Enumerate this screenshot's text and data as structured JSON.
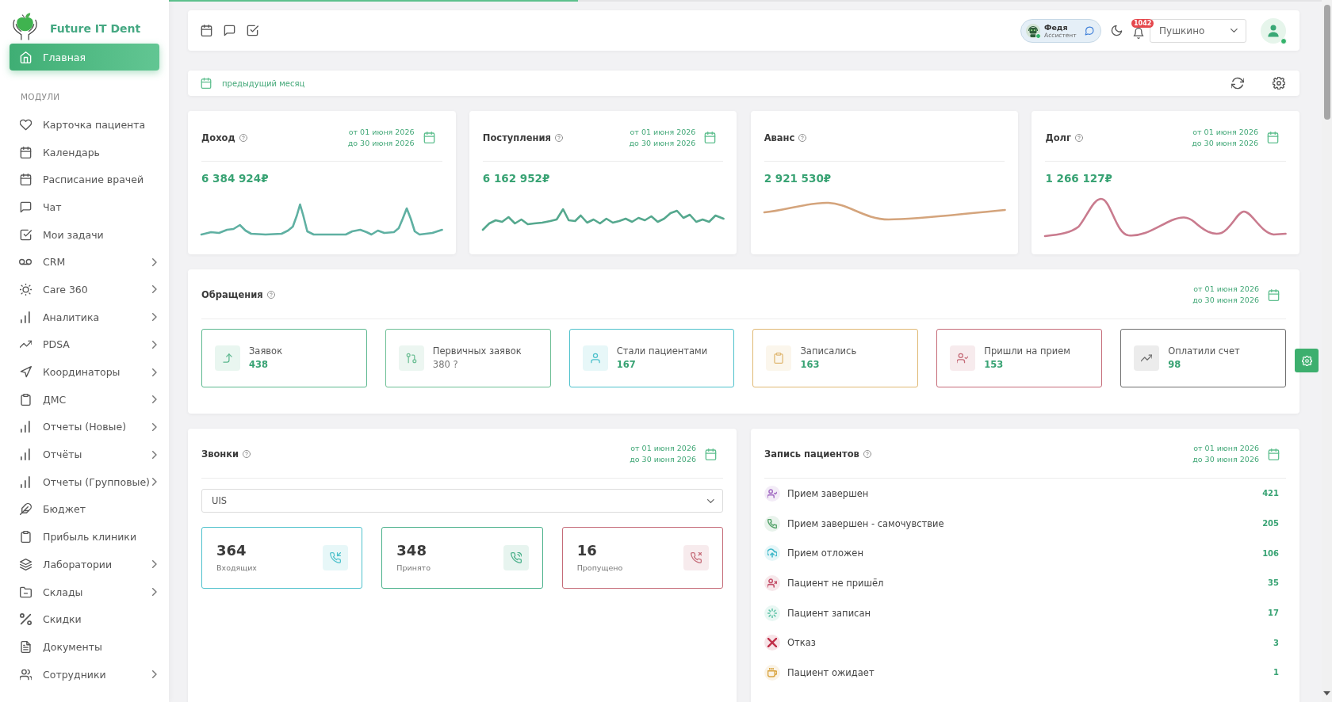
{
  "brand": {
    "name": "Future IT Dent"
  },
  "sidebar": {
    "home": {
      "label": "Главная",
      "selected": true
    },
    "section_label": "МОДУЛИ",
    "items": [
      {
        "label": "Карточка пациента",
        "selected": false,
        "has_submenu": false
      },
      {
        "label": "Календарь",
        "selected": false,
        "has_submenu": false
      },
      {
        "label": "Расписание врачей",
        "selected": false,
        "has_submenu": false
      },
      {
        "label": "Чат",
        "selected": false,
        "has_submenu": false
      },
      {
        "label": "Мои задачи",
        "selected": false,
        "has_submenu": false
      },
      {
        "label": "CRM",
        "selected": false,
        "has_submenu": true
      },
      {
        "label": "Care 360",
        "selected": false,
        "has_submenu": true
      },
      {
        "label": "Аналитика",
        "selected": false,
        "has_submenu": true
      },
      {
        "label": "PDSA",
        "selected": false,
        "has_submenu": true
      },
      {
        "label": "Координаторы",
        "selected": false,
        "has_submenu": true
      },
      {
        "label": "ДМС",
        "selected": false,
        "has_submenu": true
      },
      {
        "label": "Отчеты (Новые)",
        "selected": false,
        "has_submenu": true
      },
      {
        "label": "Отчёты",
        "selected": false,
        "has_submenu": true
      },
      {
        "label": "Отчеты (Групповые)",
        "selected": false,
        "has_submenu": true
      },
      {
        "label": "Бюджет",
        "selected": false,
        "has_submenu": false
      },
      {
        "label": "Прибыль клиники",
        "selected": false,
        "has_submenu": false
      },
      {
        "label": "Лаборатории",
        "selected": false,
        "has_submenu": true
      },
      {
        "label": "Склады",
        "selected": false,
        "has_submenu": true
      },
      {
        "label": "Скидки",
        "selected": false,
        "has_submenu": false
      },
      {
        "label": "Документы",
        "selected": false,
        "has_submenu": false
      },
      {
        "label": "Сотрудники",
        "selected": false,
        "has_submenu": true
      }
    ]
  },
  "page_loader": {
    "level": 0.355
  },
  "topbar": {
    "assistant": {
      "name": "Федя",
      "role": "Ассистент",
      "online": true
    },
    "notifications": {
      "count": "1042"
    },
    "clinic_select": {
      "value": "Пушкино"
    },
    "user": {
      "online": true
    }
  },
  "filter_bar": {
    "period": "предыдущий месяц"
  },
  "stat_cards": [
    {
      "title": "Доход",
      "date_from": "от 01 июня 2026",
      "date_to": "до 30 июня 2026",
      "value": "6 384 924₽",
      "color": "#5fb0a2"
    },
    {
      "title": "Поступления",
      "date_from": "от 01 июня 2026",
      "date_to": "до 30 июня 2026",
      "value": "6 162 952₽",
      "color": "#55a88e"
    },
    {
      "title": "Аванс",
      "value": "2 921 530₽",
      "color": "#d4a47c"
    },
    {
      "title": "Долг",
      "date_from": "от 01 июня 2026",
      "date_to": "до 30 июня 2026",
      "value": "1 266 127₽",
      "color": "#c97b8e"
    }
  ],
  "requests": {
    "title": "Обращения",
    "date_from": "от 01 июня 2026",
    "date_to": "до 30 июня 2026",
    "tiles": [
      {
        "label": "Заявок",
        "value": "438",
        "color": "#5cb88f",
        "muted": false
      },
      {
        "label": "Первичных заявок",
        "value": "380 ?",
        "color": "#6dbf95",
        "muted": true
      },
      {
        "label": "Стали пациентами",
        "value": "167",
        "color": "#4ec1cc",
        "muted": false
      },
      {
        "label": "Записались",
        "value": "163",
        "color": "#e0b873",
        "muted": false
      },
      {
        "label": "Пришли на прием",
        "value": "153",
        "color": "#c56b78",
        "muted": false
      },
      {
        "label": "Оплатили счет",
        "value": "98",
        "color": "#6e6e6e",
        "muted": false
      }
    ]
  },
  "calls": {
    "title": "Звонки",
    "date_from": "от 01 июня 2026",
    "date_to": "до 30 июня 2026",
    "source_select": {
      "value": "UIS"
    },
    "tiles": [
      {
        "value": "364",
        "label": "Входящих",
        "color": "#4ec1cc"
      },
      {
        "value": "348",
        "label": "Принято",
        "color": "#49b08a"
      },
      {
        "value": "16",
        "label": "Пропущено",
        "color": "#c56b78"
      }
    ]
  },
  "appointments": {
    "title": "Запись пациентов",
    "date_from": "от 01 июня 2026",
    "date_to": "до 30 июня 2026",
    "rows": [
      {
        "label": "Прием завершен",
        "count": "421",
        "color": "#a46fc4"
      },
      {
        "label": "Прием завершен - самочувствие",
        "count": "205",
        "color": "#5aa66f"
      },
      {
        "label": "Прием отложен",
        "count": "106",
        "color": "#3fb8c9"
      },
      {
        "label": "Пациент не пришёл",
        "count": "35",
        "color": "#c4506a"
      },
      {
        "label": "Пациент записан",
        "count": "17",
        "color": "#5cc2a6"
      },
      {
        "label": "Отказ",
        "count": "3",
        "color": "#c0304a"
      },
      {
        "label": "Пациент ожидает",
        "count": "1",
        "color": "#d9a440"
      }
    ]
  }
}
